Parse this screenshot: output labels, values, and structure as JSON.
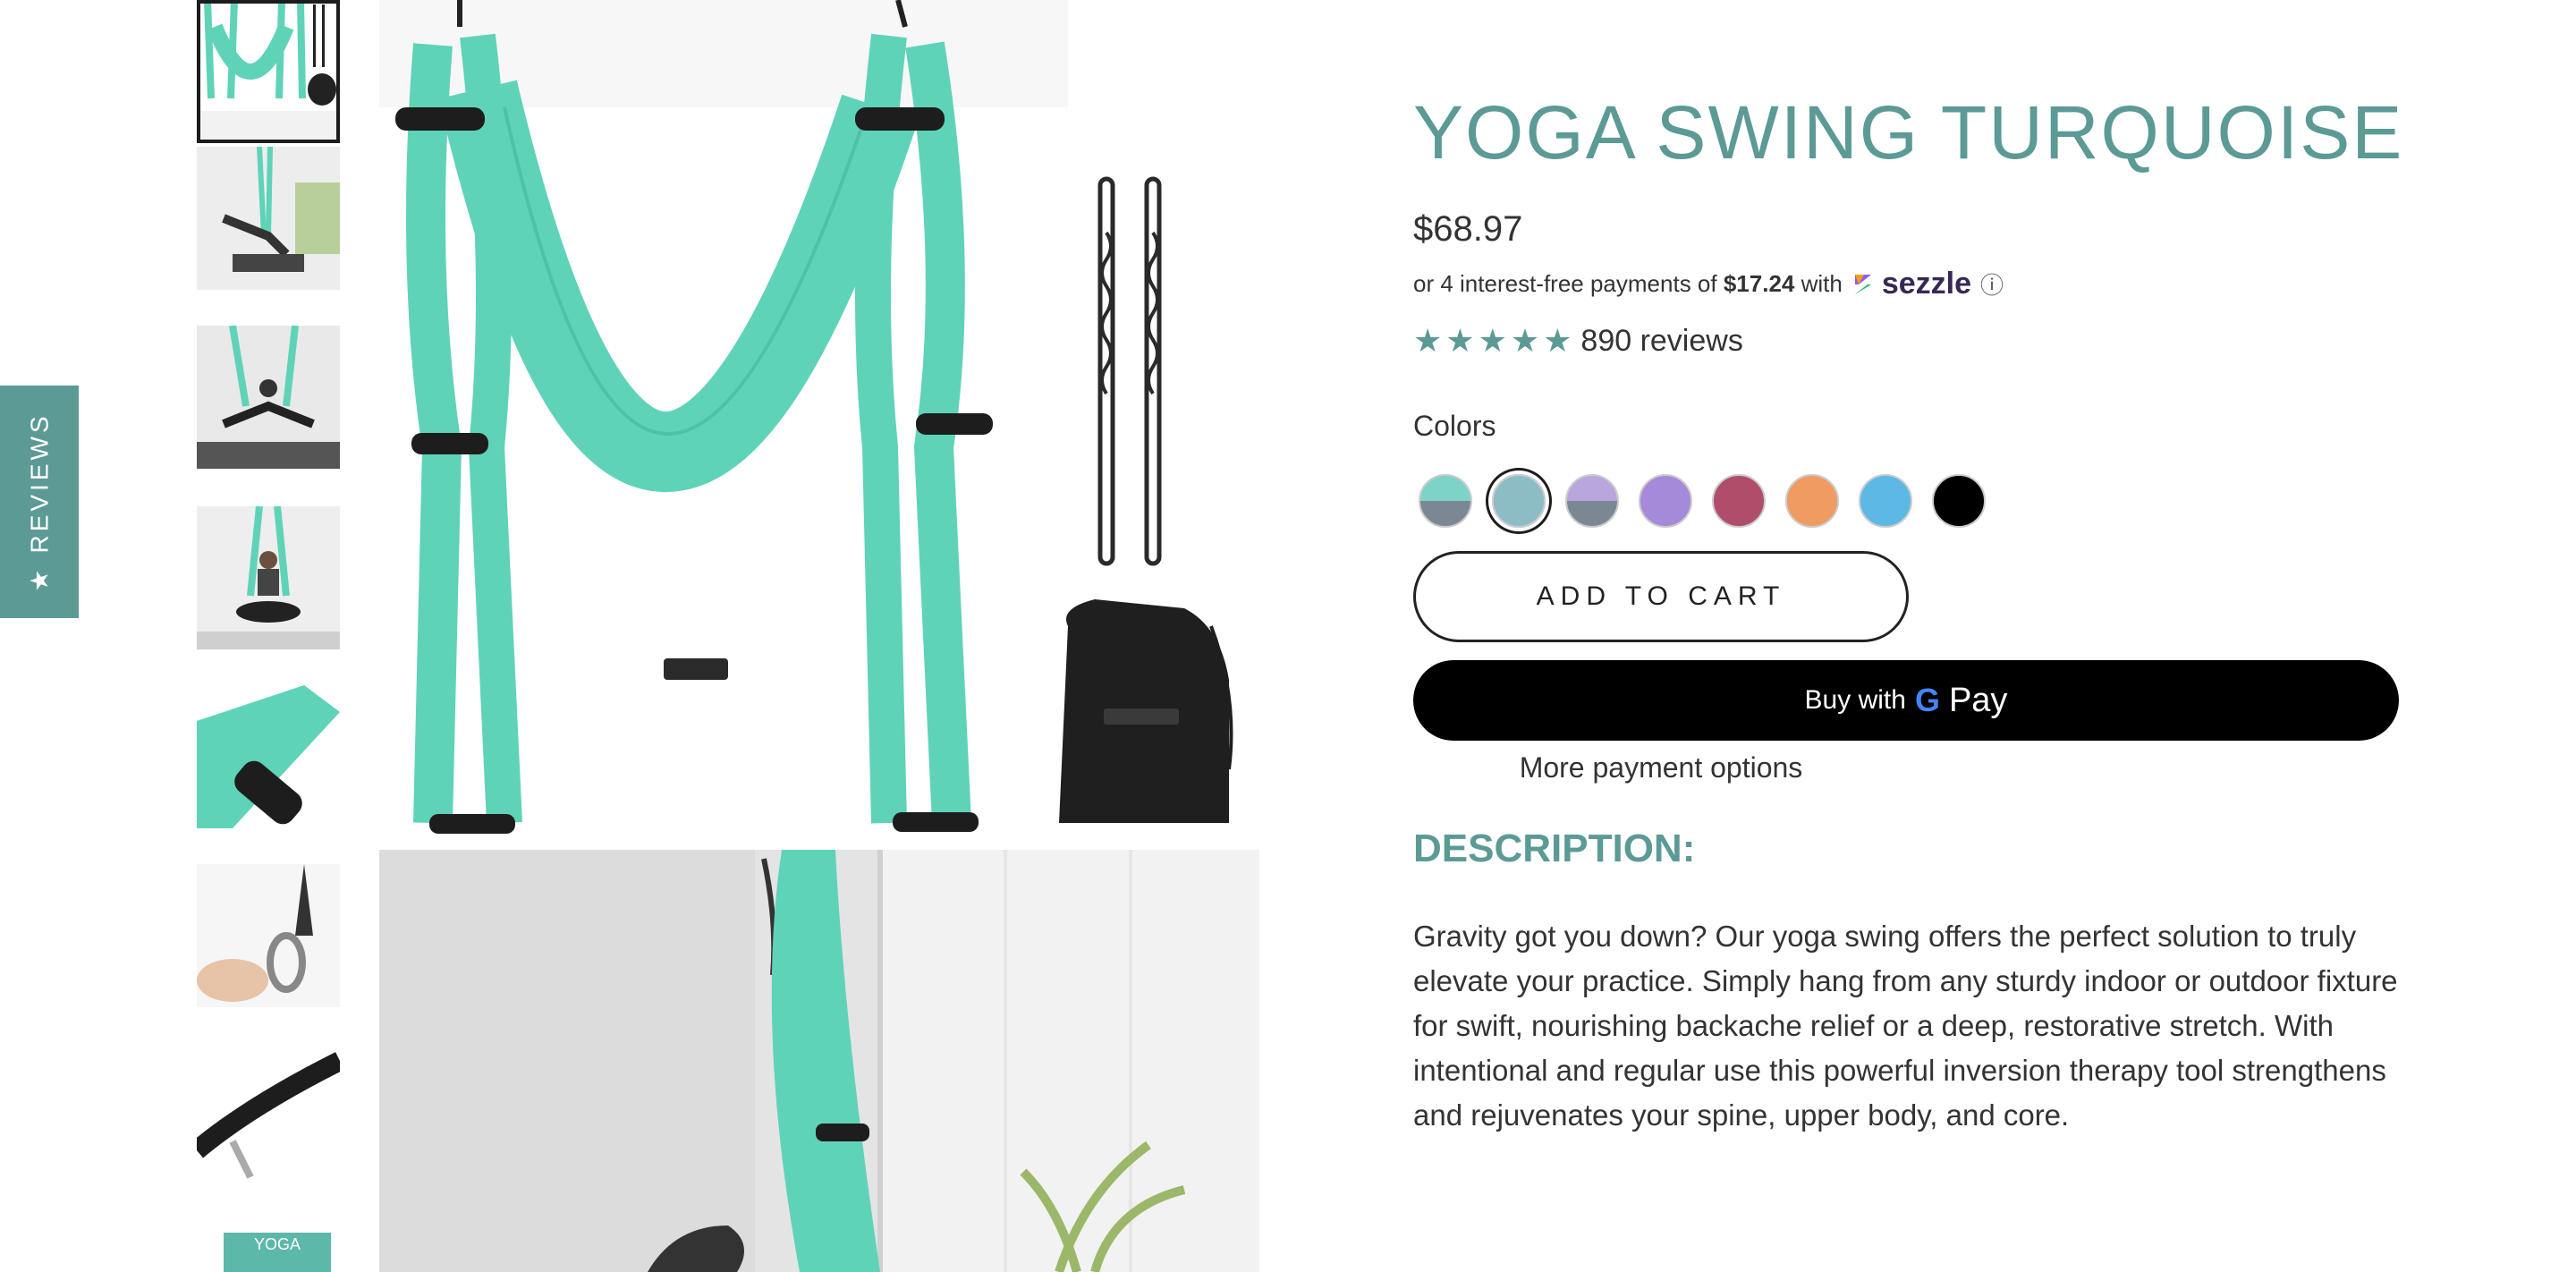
{
  "reviews_tab": {
    "label": "REVIEWS",
    "icon": "star-icon"
  },
  "product": {
    "title": "YOGA SWING TURQUOISE",
    "price": "$68.97",
    "sezzle": {
      "prefix": "or 4 interest-free payments of",
      "amount": "$17.24",
      "with": "with",
      "brand": "sezzle",
      "info": "ⓘ"
    },
    "rating": {
      "stars": 5,
      "text": "890 reviews"
    },
    "colors_label": "Colors",
    "swatches": [
      {
        "top": "#7ed3c8",
        "bottom": "#7b8894",
        "selected": false
      },
      {
        "top": "#8cbcc4",
        "bottom": "#8cbcc4",
        "selected": true
      },
      {
        "top": "#b9a6dc",
        "bottom": "#7b8894",
        "selected": false
      },
      {
        "top": "#a48ad8",
        "bottom": "#a48ad8",
        "selected": false
      },
      {
        "top": "#b04d6b",
        "bottom": "#b04d6b",
        "selected": false
      },
      {
        "top": "#ef9b62",
        "bottom": "#ef9b62",
        "selected": false
      },
      {
        "top": "#5cb8e4",
        "bottom": "#5cb8e4",
        "selected": false
      },
      {
        "top": "#000000",
        "bottom": "#000000",
        "selected": false
      }
    ],
    "add_to_cart": "ADD TO CART",
    "gpay": {
      "prefix": "Buy with",
      "g": "G",
      "pay": "Pay"
    },
    "more_payment": "More payment options",
    "description_heading": "DESCRIPTION:",
    "description": "Gravity got you down? Our yoga swing offers the perfect solution to truly elevate your practice. Simply hang from any sturdy indoor or outdoor fixture for swift, nourishing backache relief or a deep, restorative stretch. With intentional and regular use this powerful inversion therapy tool strengthens and rejuvenates your spine, upper body, and core."
  },
  "thumbnails": {
    "last_label": "YOGA"
  },
  "colors": {
    "accent": "#5c9a96",
    "fabric": "#5fd3b8",
    "dark": "#1d1d1d"
  }
}
